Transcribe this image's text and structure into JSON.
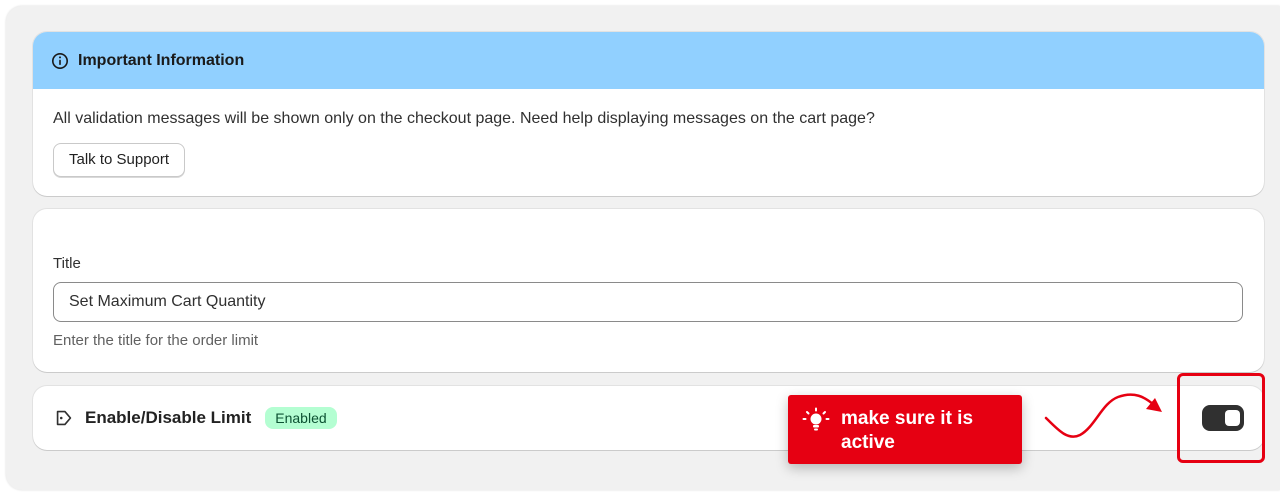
{
  "info": {
    "title": "Important Information",
    "message": "All validation messages will be shown only on the checkout page. Need help displaying messages on the cart page?",
    "support_button": "Talk to Support",
    "header_color": "#91d0ff"
  },
  "title_field": {
    "label": "Title",
    "value": "Set Maximum Cart Quantity",
    "help": "Enter the title for the order limit"
  },
  "limit": {
    "label": "Enable/Disable Limit",
    "status_badge": "Enabled",
    "toggle_on": true,
    "icon": "tag-icon"
  },
  "annotation": {
    "callout_text": "make sure it is active",
    "icon": "lightbulb-icon",
    "color": "#e60012"
  }
}
